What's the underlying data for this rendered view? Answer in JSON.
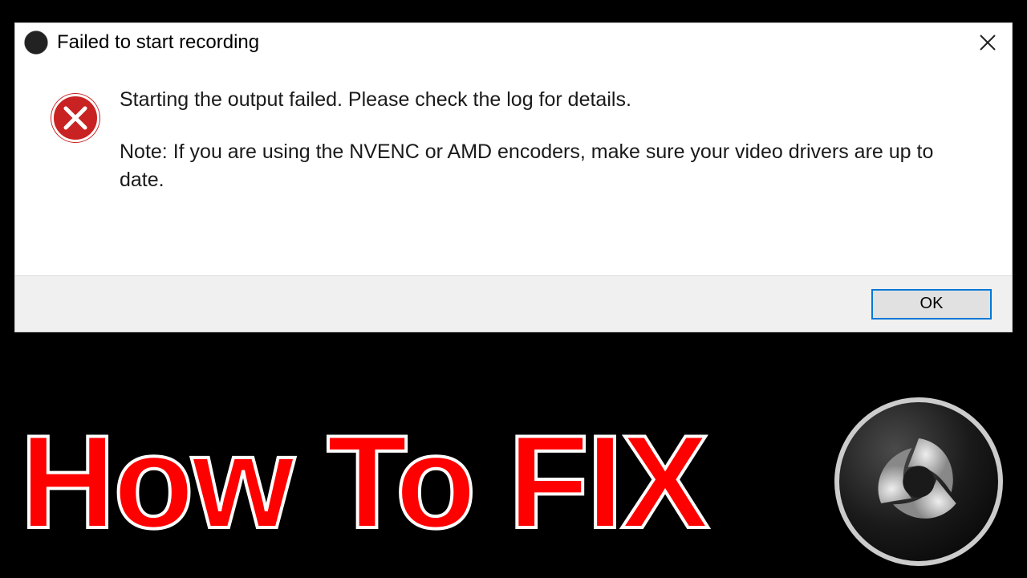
{
  "dialog": {
    "title": "Failed to start recording",
    "message_main": "Starting the output failed.  Please check the log for details.",
    "message_note": "Note: If you are using the NVENC or AMD encoders, make sure your video drivers are up to date.",
    "ok_label": "OK"
  },
  "banner": {
    "text": "How To FIX"
  }
}
